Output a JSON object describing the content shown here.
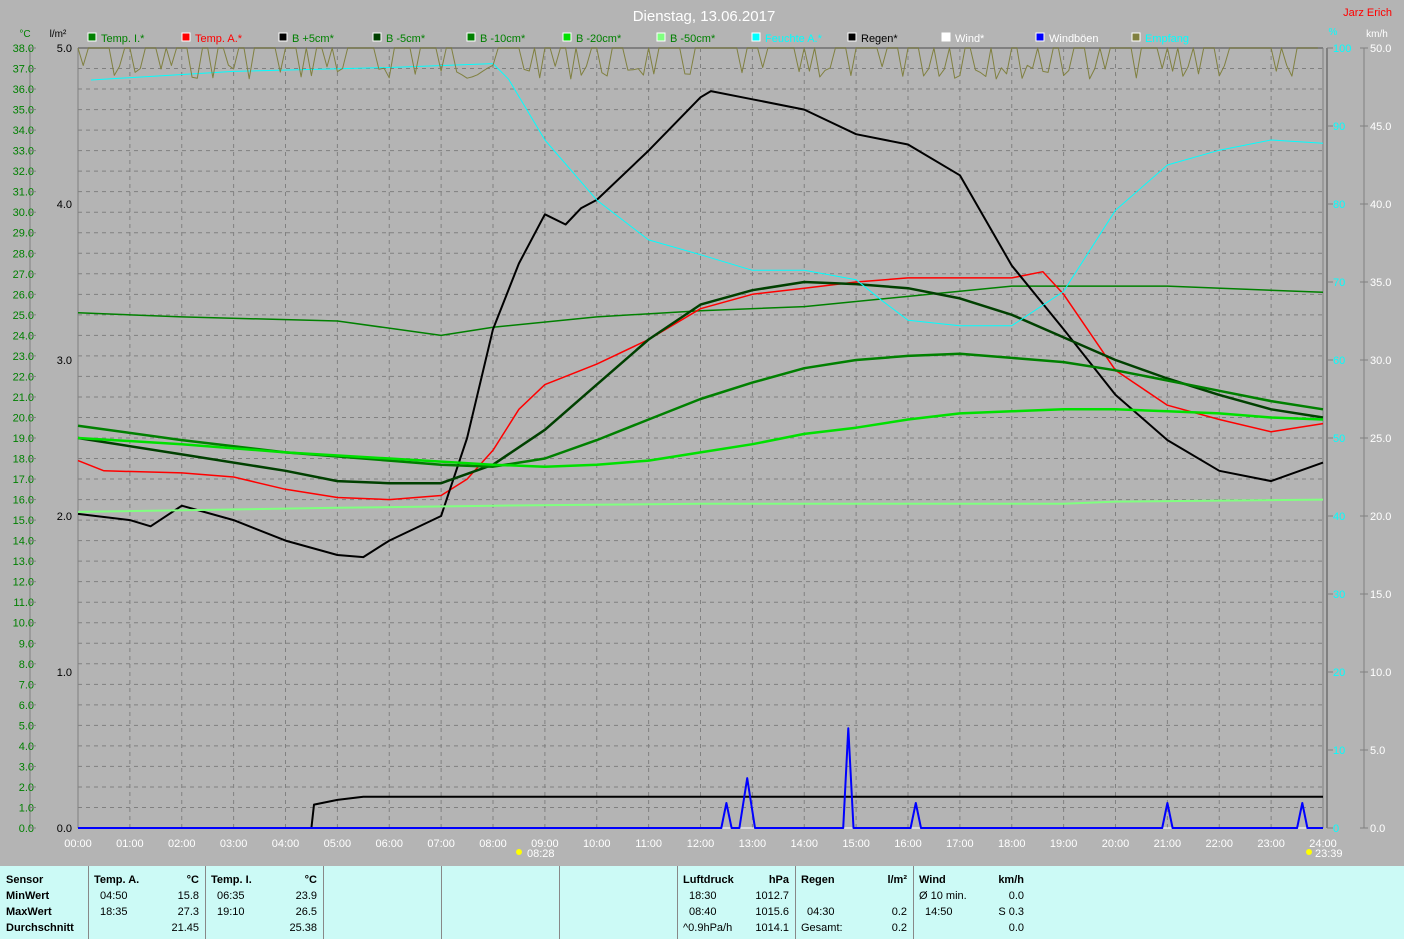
{
  "header": {
    "title": "Dienstag, 13.06.2017",
    "author": "Jarz Erich",
    "unit_temp": "°C",
    "unit_rain": "l/m²",
    "unit_hum": "%",
    "unit_wind": "km/h"
  },
  "markers": {
    "sunrise": "08:28",
    "sunset": "23:39"
  },
  "chart_data": {
    "type": "line",
    "title": "Dienstag, 13.06.2017",
    "xlabel": "",
    "x_ticks": [
      "00:00",
      "01:00",
      "02:00",
      "03:00",
      "04:00",
      "05:00",
      "06:00",
      "07:00",
      "08:00",
      "09:00",
      "10:00",
      "11:00",
      "12:00",
      "13:00",
      "14:00",
      "15:00",
      "16:00",
      "17:00",
      "18:00",
      "19:00",
      "20:00",
      "21:00",
      "22:00",
      "23:00",
      "24:00"
    ],
    "axes": {
      "temp": {
        "label": "°C",
        "range": [
          0,
          38
        ]
      },
      "rain": {
        "label": "l/m²",
        "range": [
          0,
          5
        ]
      },
      "humidity": {
        "label": "%",
        "range": [
          0,
          100
        ]
      },
      "wind": {
        "label": "km/h",
        "range": [
          0,
          50
        ]
      }
    },
    "grid": true,
    "legend_position": "top",
    "series": [
      {
        "name": "Temp. I.*",
        "axis": "temp",
        "color": "#008000",
        "width": 1.5,
        "x": [
          0,
          2,
          5,
          7,
          8,
          10,
          12,
          14,
          16,
          18,
          19.2,
          21,
          24
        ],
        "y": [
          25.1,
          24.9,
          24.7,
          24.0,
          24.4,
          24.9,
          25.2,
          25.4,
          25.9,
          26.4,
          26.4,
          26.4,
          26.1
        ]
      },
      {
        "name": "Temp. A.*",
        "axis": "temp",
        "color": "#ff0000",
        "width": 1.5,
        "x": [
          0,
          0.5,
          2,
          3,
          4,
          5,
          6,
          7,
          7.5,
          8,
          8.5,
          9,
          10,
          11,
          12,
          13,
          14,
          15,
          16,
          17,
          18,
          18.6,
          19,
          20,
          21,
          22,
          23,
          24
        ],
        "y": [
          17.9,
          17.4,
          17.3,
          17.1,
          16.5,
          16.1,
          16.0,
          16.2,
          17.0,
          18.4,
          20.4,
          21.6,
          22.6,
          23.8,
          25.3,
          26.0,
          26.3,
          26.6,
          26.8,
          26.8,
          26.8,
          27.1,
          26.0,
          22.3,
          20.6,
          19.9,
          19.3,
          19.7
        ]
      },
      {
        "name": "B +5cm*",
        "axis": "temp",
        "color": "#000000",
        "width": 2,
        "x": [
          0,
          1,
          1.4,
          2,
          3,
          4,
          5,
          5.5,
          6,
          7,
          7.5,
          8,
          8.5,
          9,
          9.4,
          9.7,
          10,
          11,
          12,
          12.2,
          13,
          14,
          15,
          16,
          17,
          18,
          19,
          20,
          21,
          22,
          23,
          24
        ],
        "y": [
          15.3,
          15.0,
          14.7,
          15.7,
          15.0,
          14.0,
          13.3,
          13.2,
          14.0,
          15.2,
          19.0,
          24.3,
          27.5,
          29.9,
          29.4,
          30.2,
          30.6,
          33.0,
          35.6,
          35.9,
          35.5,
          35.0,
          33.8,
          33.3,
          31.8,
          27.4,
          24.3,
          21.1,
          18.9,
          17.4,
          16.9,
          17.8
        ]
      },
      {
        "name": "B -5cm*",
        "axis": "temp",
        "color": "#004000",
        "width": 2.5,
        "x": [
          0,
          2,
          4,
          5,
          6,
          7,
          8,
          9,
          10,
          11,
          12,
          13,
          14,
          15,
          16,
          17,
          18,
          19,
          20,
          21,
          22,
          23,
          24
        ],
        "y": [
          19.0,
          18.2,
          17.4,
          16.9,
          16.8,
          16.8,
          17.7,
          19.4,
          21.6,
          23.8,
          25.5,
          26.2,
          26.6,
          26.5,
          26.3,
          25.8,
          25.0,
          23.9,
          22.8,
          21.9,
          21.1,
          20.4,
          20.0
        ]
      },
      {
        "name": "B -10cm*",
        "axis": "temp",
        "color": "#008000",
        "width": 2.5,
        "x": [
          0,
          2,
          4,
          6,
          7,
          8,
          9,
          10,
          11,
          12,
          13,
          14,
          15,
          16,
          17,
          18,
          19,
          20,
          21,
          22,
          23,
          24
        ],
        "y": [
          19.6,
          18.9,
          18.3,
          17.9,
          17.7,
          17.6,
          18.0,
          18.9,
          19.9,
          20.9,
          21.7,
          22.4,
          22.8,
          23.0,
          23.1,
          22.9,
          22.7,
          22.3,
          21.8,
          21.3,
          20.8,
          20.4
        ]
      },
      {
        "name": "B -20cm*",
        "axis": "temp",
        "color": "#00e000",
        "width": 2.5,
        "x": [
          0,
          2,
          4,
          6,
          8,
          9,
          10,
          11,
          12,
          13,
          14,
          15,
          16,
          17,
          18,
          19,
          20,
          21,
          22,
          23,
          24
        ],
        "y": [
          19.0,
          18.7,
          18.3,
          18.0,
          17.7,
          17.6,
          17.7,
          17.9,
          18.3,
          18.7,
          19.2,
          19.5,
          19.9,
          20.2,
          20.3,
          20.4,
          20.4,
          20.3,
          20.2,
          20.0,
          19.9
        ]
      },
      {
        "name": "B -50cm*",
        "axis": "temp",
        "color": "#80ff80",
        "width": 2,
        "x": [
          0,
          5,
          8,
          12,
          19,
          20,
          24
        ],
        "y": [
          15.4,
          15.6,
          15.7,
          15.8,
          15.8,
          15.9,
          16.0
        ]
      },
      {
        "name": "Feuchte A.*",
        "axis": "humidity",
        "color": "#00ffff",
        "width": 1,
        "x": [
          0.25,
          3,
          6,
          8,
          8.3,
          9,
          10,
          11,
          12,
          13,
          14,
          15,
          15.5,
          16,
          17,
          18,
          19,
          20,
          21,
          22,
          23,
          24
        ],
        "y": [
          95.9,
          97.0,
          97.5,
          98.0,
          96.0,
          88.2,
          80.5,
          75.4,
          73.5,
          71.5,
          71.5,
          70.3,
          67.6,
          65.1,
          64.4,
          64.4,
          68.8,
          79.2,
          85.0,
          86.9,
          88.2,
          87.8
        ]
      },
      {
        "name": "Regen*",
        "axis": "rain",
        "color": "#000000",
        "width": 2,
        "x": [
          0,
          4.5,
          4.55,
          5,
          5.5,
          6,
          24
        ],
        "y": [
          0,
          0,
          0.15,
          0.18,
          0.2,
          0.2,
          0.2
        ]
      },
      {
        "name": "Wind*",
        "axis": "wind",
        "color": "#ffffff",
        "width": 1,
        "x": [
          0,
          24
        ],
        "y": [
          0,
          0
        ]
      },
      {
        "name": "Windböen",
        "axis": "wind",
        "color": "#0000ff",
        "width": 2,
        "x": [
          0,
          12.4,
          12.5,
          12.6,
          12.75,
          12.9,
          13.05,
          14.75,
          14.85,
          14.95,
          16.05,
          16.15,
          16.25,
          20.9,
          21.0,
          21.1,
          23.5,
          23.6,
          23.7,
          24
        ],
        "y": [
          0,
          0,
          1.6,
          0,
          0,
          3.2,
          0,
          0,
          6.4,
          0,
          0,
          1.6,
          0,
          0,
          1.6,
          0,
          0,
          1.6,
          0,
          0
        ]
      },
      {
        "name": "Empfang",
        "axis": "humidity",
        "color": "#808040",
        "width": 1,
        "x": [
          0,
          24
        ],
        "y": [
          100,
          100
        ]
      }
    ]
  },
  "stats": {
    "sensor": {
      "h": "Sensor",
      "min": "MinWert",
      "max": "MaxWert",
      "avg": "Durchschnitt"
    },
    "tempA": {
      "h": "Temp. A.",
      "u": "°C",
      "min_t": "04:50",
      "min": "15.8",
      "max_t": "18:35",
      "max": "27.3",
      "avg": "21.45"
    },
    "tempI": {
      "h": "Temp. I.",
      "u": "°C",
      "min_t": "06:35",
      "min": "23.9",
      "max_t": "19:10",
      "max": "26.5",
      "avg": "25.38"
    },
    "press": {
      "h": "Luftdruck",
      "u": "hPa",
      "min_t": "18:30",
      "min": "1012.7",
      "max_t": "08:40",
      "max": "1015.6",
      "trend": "^0.9hPa/h",
      "avg": "1014.1"
    },
    "rain": {
      "h": "Regen",
      "u": "l/m²",
      "max_t": "04:30",
      "max": "0.2",
      "total_l": "Gesamt:",
      "total": "0.2"
    },
    "wind": {
      "h": "Wind",
      "u": "km/h",
      "avg_l": "Ø 10 min.",
      "avg": "0.0",
      "max_t": "14:50",
      "max": "S 0.3",
      "mean": "0.0"
    }
  }
}
